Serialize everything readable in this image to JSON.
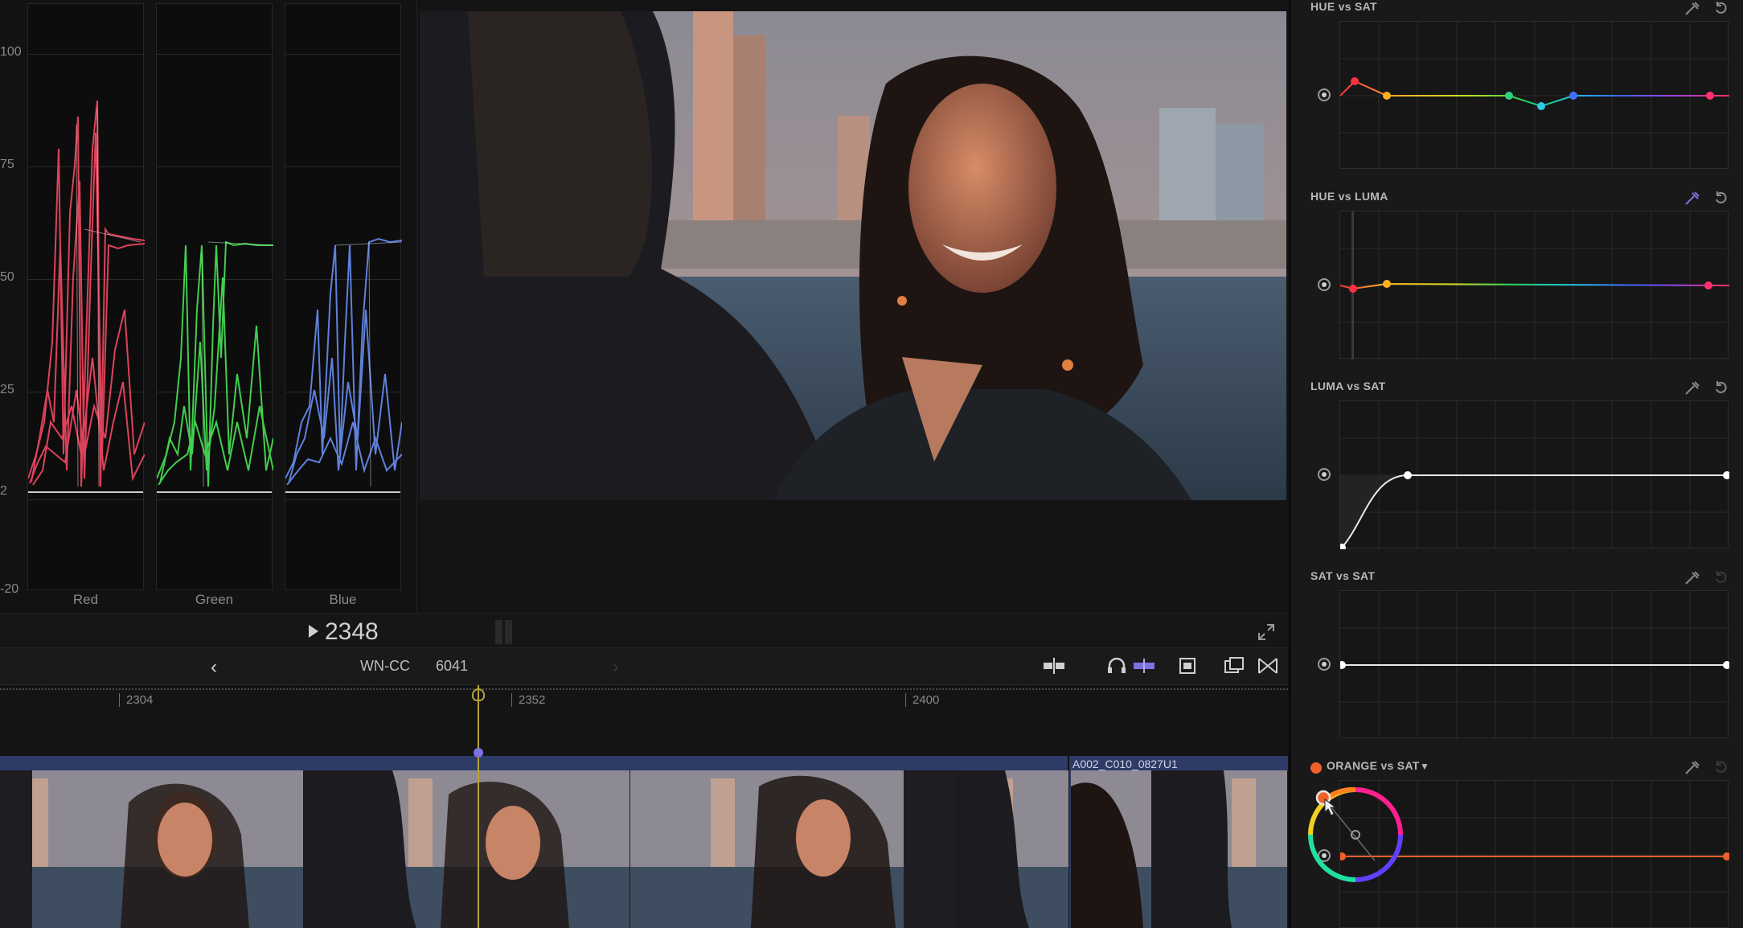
{
  "scopes": {
    "scale": [
      "100",
      "75",
      "50",
      "25",
      "2",
      "-20"
    ],
    "channels": [
      {
        "label": "Red",
        "color": "#ff5a6e"
      },
      {
        "label": "Green",
        "color": "#5cf06a"
      },
      {
        "label": "Blue",
        "color": "#6e9cff"
      }
    ]
  },
  "playback": {
    "timecode": "2348"
  },
  "timeline": {
    "project_name": "WN-CC",
    "frame_count": "6041",
    "ruler_ticks": [
      "2304",
      "2352",
      "2400"
    ],
    "clip_name": "A002_C010_0827U1"
  },
  "curves": {
    "sections": [
      {
        "title": "HUE vs SAT"
      },
      {
        "title": "HUE vs LUMA"
      },
      {
        "title": "LUMA vs SAT"
      },
      {
        "title": "SAT vs SAT"
      },
      {
        "title": "ORANGE vs SAT"
      }
    ],
    "accent_orange": "#f0602a",
    "eyedropper_active": "#7c72e0"
  }
}
